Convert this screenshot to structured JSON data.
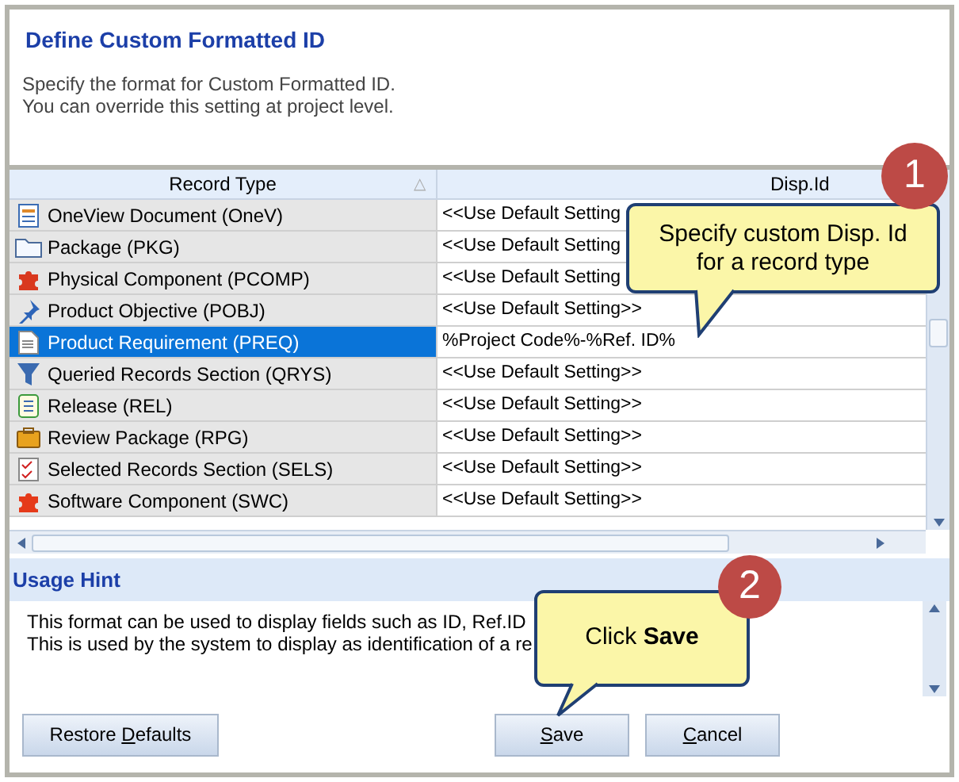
{
  "dialog": {
    "title": "Define Custom Formatted ID",
    "description": [
      "Specify the format for Custom Formatted ID.",
      "You can override this setting at project level."
    ]
  },
  "table": {
    "columns": [
      {
        "label": "Record Type",
        "sort_icon": "△"
      },
      {
        "label": "Disp.Id"
      }
    ],
    "rows": [
      {
        "record_type": "OneView Document (OneV)",
        "disp_id": "<<Use Default Setting",
        "selected": false
      },
      {
        "record_type": "Package (PKG)",
        "disp_id": "<<Use Default Setting",
        "selected": false
      },
      {
        "record_type": "Physical Component (PCOMP)",
        "disp_id": "<<Use Default Setting",
        "selected": false
      },
      {
        "record_type": "Product Objective (POBJ)",
        "disp_id": "<<Use Default Setting>>",
        "selected": false
      },
      {
        "record_type": "Product Requirement (PREQ)",
        "disp_id": "%Project Code%-%Ref. ID%",
        "selected": true
      },
      {
        "record_type": "Queried Records Section (QRYS)",
        "disp_id": "<<Use Default Setting>>",
        "selected": false
      },
      {
        "record_type": "Release (REL)",
        "disp_id": "<<Use Default Setting>>",
        "selected": false
      },
      {
        "record_type": "Review Package (RPG)",
        "disp_id": "<<Use Default Setting>>",
        "selected": false
      },
      {
        "record_type": "Selected Records Section (SELS)",
        "disp_id": "<<Use Default Setting>>",
        "selected": false
      },
      {
        "record_type": "Software Component (SWC)",
        "disp_id": "<<Use Default Setting>>",
        "selected": false
      }
    ]
  },
  "usage_hint": {
    "title": "Usage Hint",
    "lines": [
      "This format can be used to display fields such as ID, Ref.ID",
      "This is used by the system to display as identification of a re"
    ]
  },
  "buttons": [
    {
      "before": "Restore ",
      "accelerator": "D",
      "after": "efaults"
    },
    {
      "accelerator": "S",
      "after": "ave"
    },
    {
      "accelerator": "C",
      "after": "ancel"
    }
  ],
  "callouts": [
    {
      "number": "1",
      "text": "Specify custom Disp. Id for a record type"
    },
    {
      "number": "2",
      "text": "Click **Save**"
    }
  ]
}
